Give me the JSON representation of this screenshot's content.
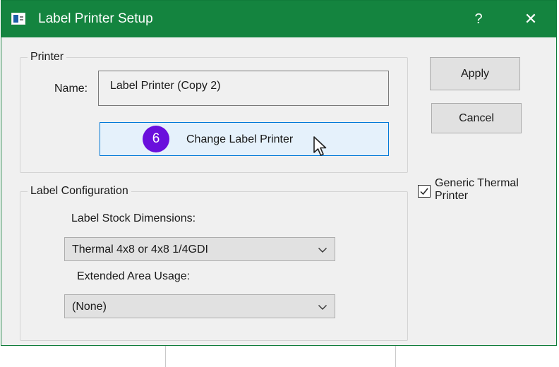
{
  "window": {
    "title": "Label Printer Setup",
    "help_label": "?",
    "close_label": "✕",
    "accent_color": "#14843f"
  },
  "printer_group": {
    "title": "Printer",
    "name_label": "Name:",
    "name_value": "Label  Printer (Copy 2)",
    "change_button_label": "Change Label Printer",
    "step_badge": "6"
  },
  "label_config": {
    "title": "Label Configuration",
    "stock_label": "Label Stock Dimensions:",
    "stock_value": "Thermal 4x8 or 4x8 1/4GDI",
    "extended_label": "Extended Area Usage:",
    "extended_value": "(None)"
  },
  "buttons": {
    "apply": "Apply",
    "cancel": "Cancel"
  },
  "generic_thermal": {
    "label": "Generic Thermal\nPrinter",
    "checked": true
  },
  "icons": {
    "app": "label-printer-app-icon",
    "cursor": "mouse-pointer-icon",
    "dropdown": "chevron-down-icon",
    "check": "checkmark-icon"
  }
}
